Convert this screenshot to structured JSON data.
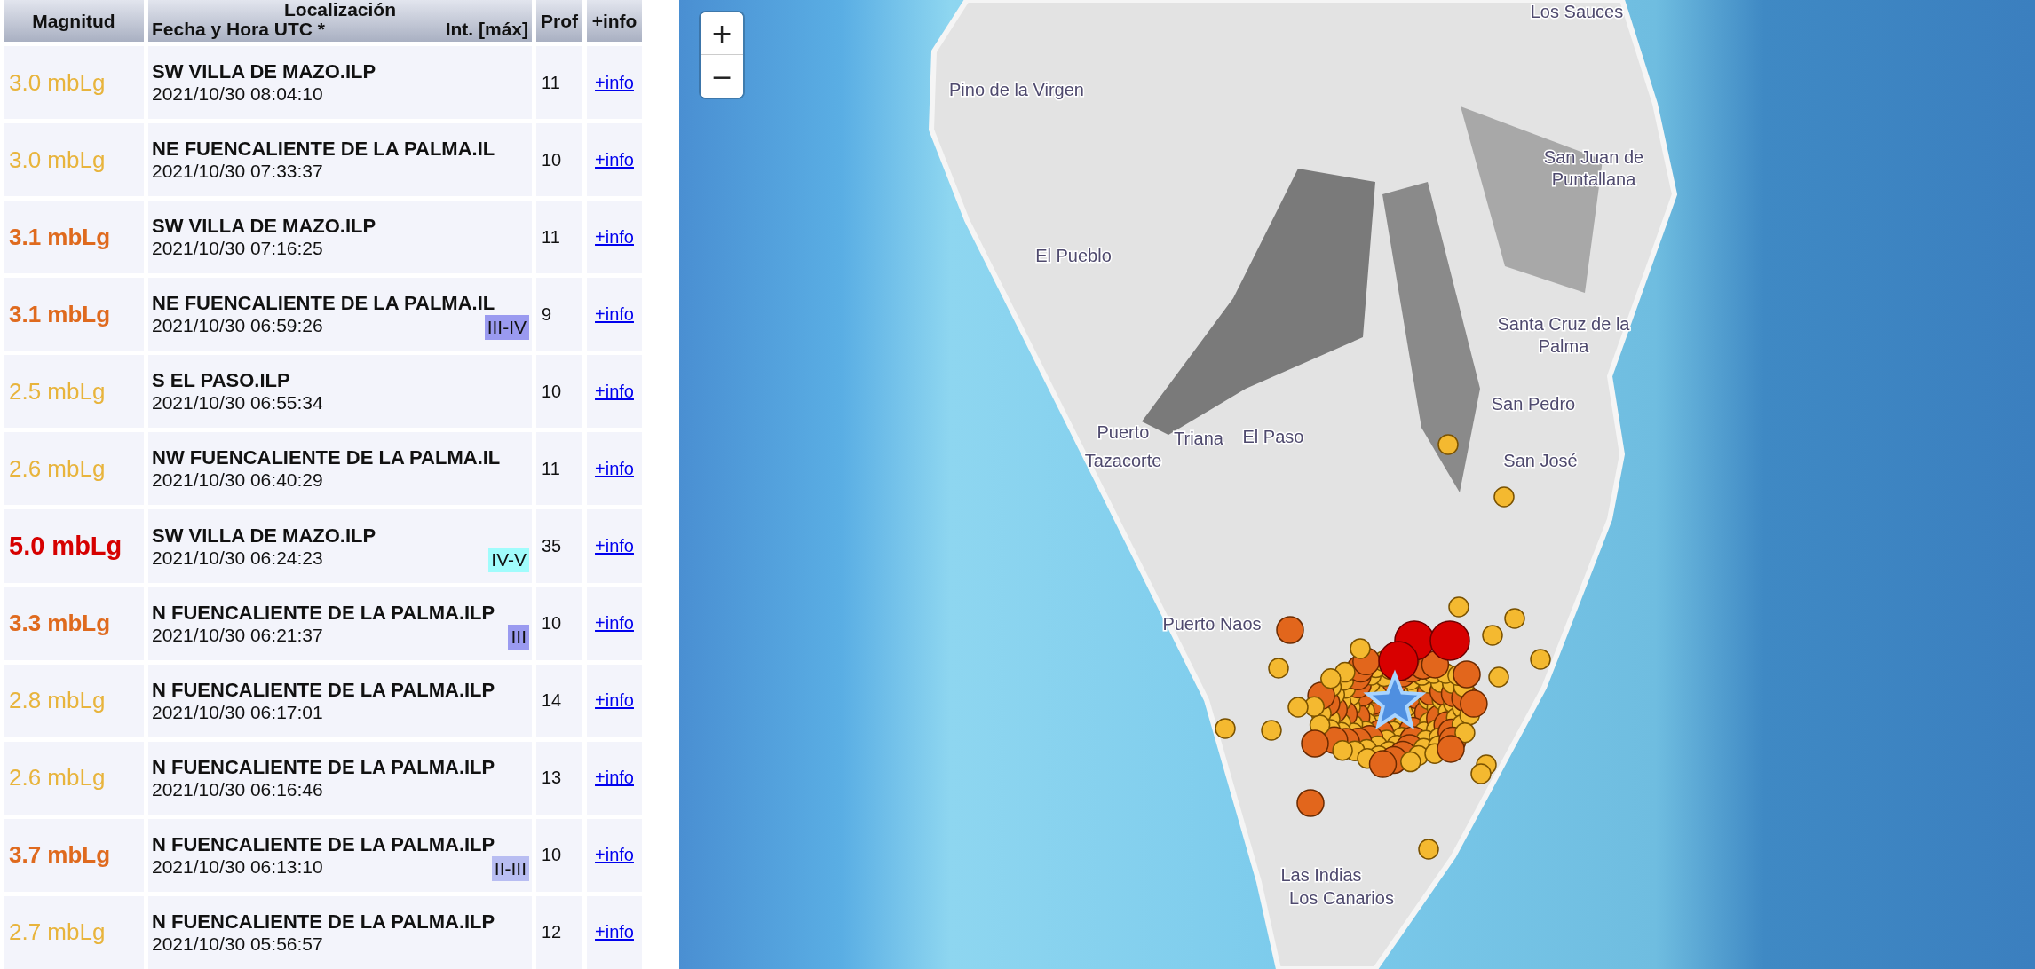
{
  "table": {
    "columns": {
      "magnitude": "Magnitud",
      "location": "Localización",
      "datetime": "Fecha y Hora UTC *",
      "intensity": "Int. [máx]",
      "depth": "Prof",
      "info": "+info"
    },
    "rows": [
      {
        "magnitude": "3.0 mbLg",
        "kind": "light",
        "location": "SW VILLA DE MAZO.ILP",
        "datetime": "2021/10/30 08:04:10",
        "depth": "11",
        "link": "+info"
      },
      {
        "magnitude": "3.0 mbLg",
        "kind": "light",
        "location": "NE FUENCALIENTE DE LA PALMA.IL",
        "datetime": "2021/10/30 07:33:37",
        "depth": "10",
        "link": "+info"
      },
      {
        "magnitude": "3.1 mbLg",
        "kind": "moderate",
        "location": "SW VILLA DE MAZO.ILP",
        "datetime": "2021/10/30 07:16:25",
        "depth": "11",
        "link": "+info"
      },
      {
        "magnitude": "3.1 mbLg",
        "kind": "moderate",
        "location": "NE FUENCALIENTE DE LA PALMA.IL",
        "datetime": "2021/10/30 06:59:26",
        "intensity": {
          "text": "III-IV",
          "color": "#9a9af0"
        },
        "depth": "9",
        "link": "+info"
      },
      {
        "magnitude": "2.5 mbLg",
        "kind": "light",
        "location": "S EL PASO.ILP",
        "datetime": "2021/10/30 06:55:34",
        "depth": "10",
        "link": "+info"
      },
      {
        "magnitude": "2.6 mbLg",
        "kind": "light",
        "location": "NW FUENCALIENTE DE LA PALMA.IL",
        "datetime": "2021/10/30 06:40:29",
        "depth": "11",
        "link": "+info"
      },
      {
        "magnitude": "5.0 mbLg",
        "kind": "strong",
        "location": "SW VILLA DE MAZO.ILP",
        "datetime": "2021/10/30 06:24:23",
        "intensity": {
          "text": "IV-V",
          "color": "#a0fcfc"
        },
        "depth": "35",
        "link": "+info"
      },
      {
        "magnitude": "3.3 mbLg",
        "kind": "moderate",
        "location": "N FUENCALIENTE DE LA PALMA.ILP",
        "datetime": "2021/10/30 06:21:37",
        "intensity": {
          "text": "III",
          "color": "#9a9af0"
        },
        "depth": "10",
        "link": "+info"
      },
      {
        "magnitude": "2.8 mbLg",
        "kind": "light",
        "location": "N FUENCALIENTE DE LA PALMA.ILP",
        "datetime": "2021/10/30 06:17:01",
        "depth": "14",
        "link": "+info"
      },
      {
        "magnitude": "2.6 mbLg",
        "kind": "light",
        "location": "N FUENCALIENTE DE LA PALMA.ILP",
        "datetime": "2021/10/30 06:16:46",
        "depth": "13",
        "link": "+info"
      },
      {
        "magnitude": "3.7 mbLg",
        "kind": "moderate",
        "location": "N FUENCALIENTE DE LA PALMA.ILP",
        "datetime": "2021/10/30 06:13:10",
        "intensity": {
          "text": "II-III",
          "color": "#b8bdf2"
        },
        "depth": "10",
        "link": "+info"
      },
      {
        "magnitude": "2.7 mbLg",
        "kind": "light",
        "location": "N FUENCALIENTE DE LA PALMA.ILP",
        "datetime": "2021/10/30 05:56:57",
        "depth": "12",
        "link": "+info"
      }
    ]
  },
  "map": {
    "zoom_in": "+",
    "zoom_out": "−",
    "places": [
      {
        "lines": [
          "Los Sauces"
        ]
      },
      {
        "lines": [
          "Pino de la Virgen"
        ]
      },
      {
        "lines": [
          "San Juan de",
          "Puntallana"
        ]
      },
      {
        "lines": [
          "El Pueblo"
        ]
      },
      {
        "lines": [
          "Santa Cruz de la",
          "Palma"
        ]
      },
      {
        "lines": [
          "San Pedro"
        ]
      },
      {
        "lines": [
          "San José"
        ]
      },
      {
        "lines": [
          "Puerto",
          "Tazacorte"
        ]
      },
      {
        "lines": [
          "Triana"
        ]
      },
      {
        "lines": [
          "El Paso"
        ]
      },
      {
        "lines": [
          "Puerto Naos"
        ]
      },
      {
        "lines": [
          "Las Indias"
        ]
      },
      {
        "lines": [
          "Los Canarios"
        ]
      }
    ]
  }
}
